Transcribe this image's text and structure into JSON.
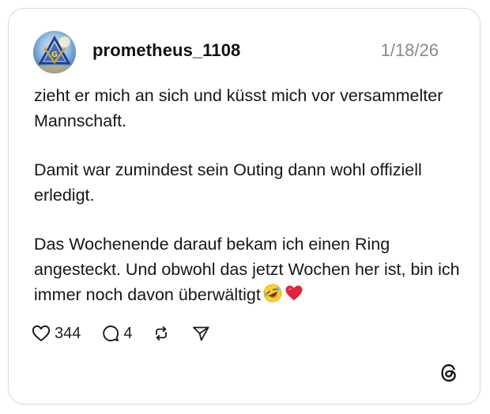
{
  "post": {
    "username": "prometheus_1108",
    "date": "1/18/26",
    "paragraphs": [
      "zieht er mich an sich und küsst mich vor versammelter Mannschaft.",
      "Damit war zumindest sein Outing dann wohl offiziell erledigt.",
      "Das Wochenende darauf bekam ich einen Ring angesteckt. Und obwohl das jetzt Wochen her ist, bin ich immer noch davon überwältigt"
    ],
    "emojis": [
      "rolling-on-floor-laughing-emoji",
      "red-heart-emoji"
    ],
    "likes": "344",
    "replies": "4"
  },
  "icons": {
    "like": "heart-outline-icon",
    "reply": "speech-bubble-icon",
    "repost": "repost-arrows-icon",
    "share": "paper-plane-icon",
    "brand": "threads-logo-icon"
  },
  "colors": {
    "text": "#161616",
    "muted": "#8a8a8a",
    "border": "#d9d9d9",
    "heart": "#e0243a"
  }
}
